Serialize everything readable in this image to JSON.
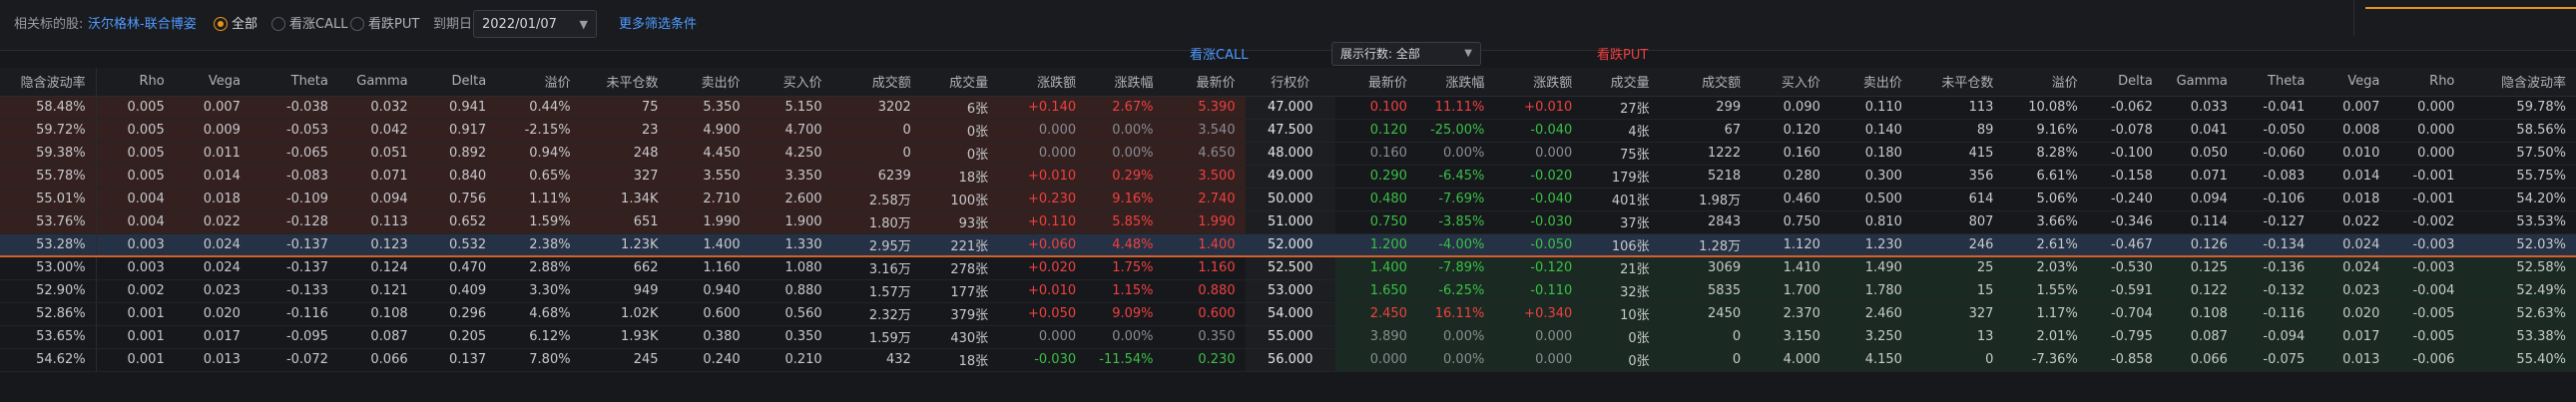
{
  "toolbar": {
    "related_label": "相关标的股:",
    "related_link": "沃尔格林-联合博姿",
    "filter_all": "全部",
    "filter_call": "看涨CALL",
    "filter_put": "看跌PUT",
    "expiry_label": "到期日",
    "expiry_value": "2022/01/07",
    "more_filters": "更多筛选条件"
  },
  "section": {
    "call_title": "看涨CALL",
    "put_title": "看跌PUT",
    "rows_label": "展示行数: 全部"
  },
  "colors": {
    "up": "#ef4040",
    "down": "#3bbf46",
    "accent": "#e8941b",
    "link": "#4f9bff",
    "itm_bg": "#33201f",
    "otm_bg": "#1a2a22"
  },
  "columns": [
    "隐含波动率",
    "Rho",
    "Vega",
    "Theta",
    "Gamma",
    "Delta",
    "溢价",
    "未平仓数",
    "卖出价",
    "买入价",
    "成交额",
    "成交量",
    "涨跌额",
    "涨跌幅",
    "最新价",
    "行权价",
    "最新价",
    "涨跌幅",
    "涨跌额",
    "成交量",
    "成交额",
    "买入价",
    "卖出价",
    "未平仓数",
    "溢价",
    "Delta",
    "Gamma",
    "Theta",
    "Vega",
    "Rho",
    "隐含波动率"
  ],
  "rows": [
    {
      "call": [
        "58.48%",
        "0.005",
        "0.007",
        "-0.038",
        "0.032",
        "0.941",
        "0.44%",
        "75",
        "5.350",
        "5.150",
        "3202",
        "6张",
        "+0.140",
        "2.67%",
        "5.390"
      ],
      "call_dir": "up",
      "strike": "47.000",
      "put": [
        "0.100",
        "11.11%",
        "+0.010",
        "27张",
        "299",
        "0.090",
        "0.110",
        "113",
        "10.08%",
        "-0.062",
        "0.033",
        "-0.041",
        "0.007",
        "0.000",
        "59.78%"
      ],
      "put_dir": "up"
    },
    {
      "call": [
        "59.72%",
        "0.005",
        "0.009",
        "-0.053",
        "0.042",
        "0.917",
        "-2.15%",
        "23",
        "4.900",
        "4.700",
        "0",
        "0张",
        "0.000",
        "0.00%",
        "3.540"
      ],
      "call_dir": "flat",
      "strike": "47.500",
      "put": [
        "0.120",
        "-25.00%",
        "-0.040",
        "4张",
        "67",
        "0.120",
        "0.140",
        "89",
        "9.16%",
        "-0.078",
        "0.041",
        "-0.050",
        "0.008",
        "0.000",
        "58.56%"
      ],
      "put_dir": "down"
    },
    {
      "call": [
        "59.38%",
        "0.005",
        "0.011",
        "-0.065",
        "0.051",
        "0.892",
        "0.94%",
        "248",
        "4.450",
        "4.250",
        "0",
        "0张",
        "0.000",
        "0.00%",
        "4.650"
      ],
      "call_dir": "flat",
      "strike": "48.000",
      "put": [
        "0.160",
        "0.00%",
        "0.000",
        "75张",
        "1222",
        "0.160",
        "0.180",
        "415",
        "8.28%",
        "-0.100",
        "0.050",
        "-0.060",
        "0.010",
        "0.000",
        "57.50%"
      ],
      "put_dir": "flat"
    },
    {
      "call": [
        "55.78%",
        "0.005",
        "0.014",
        "-0.083",
        "0.071",
        "0.840",
        "0.65%",
        "327",
        "3.550",
        "3.350",
        "6239",
        "18张",
        "+0.010",
        "0.29%",
        "3.500"
      ],
      "call_dir": "up",
      "strike": "49.000",
      "put": [
        "0.290",
        "-6.45%",
        "-0.020",
        "179张",
        "5218",
        "0.280",
        "0.300",
        "356",
        "6.61%",
        "-0.158",
        "0.071",
        "-0.083",
        "0.014",
        "-0.001",
        "55.75%"
      ],
      "put_dir": "down"
    },
    {
      "call": [
        "55.01%",
        "0.004",
        "0.018",
        "-0.109",
        "0.094",
        "0.756",
        "1.11%",
        "1.34K",
        "2.710",
        "2.600",
        "2.58万",
        "100张",
        "+0.230",
        "9.16%",
        "2.740"
      ],
      "call_dir": "up",
      "strike": "50.000",
      "put": [
        "0.480",
        "-7.69%",
        "-0.040",
        "401张",
        "1.98万",
        "0.460",
        "0.500",
        "614",
        "5.06%",
        "-0.240",
        "0.094",
        "-0.106",
        "0.018",
        "-0.001",
        "54.20%"
      ],
      "put_dir": "down"
    },
    {
      "call": [
        "53.76%",
        "0.004",
        "0.022",
        "-0.128",
        "0.113",
        "0.652",
        "1.59%",
        "651",
        "1.990",
        "1.900",
        "1.80万",
        "93张",
        "+0.110",
        "5.85%",
        "1.990"
      ],
      "call_dir": "up",
      "strike": "51.000",
      "put": [
        "0.750",
        "-3.85%",
        "-0.030",
        "37张",
        "2843",
        "0.750",
        "0.810",
        "807",
        "3.66%",
        "-0.346",
        "0.114",
        "-0.127",
        "0.022",
        "-0.002",
        "53.53%"
      ],
      "put_dir": "down"
    },
    {
      "call": [
        "53.28%",
        "0.003",
        "0.024",
        "-0.137",
        "0.123",
        "0.532",
        "2.38%",
        "1.23K",
        "1.400",
        "1.330",
        "2.95万",
        "221张",
        "+0.060",
        "4.48%",
        "1.400"
      ],
      "call_dir": "up",
      "strike": "52.000",
      "put": [
        "1.200",
        "-4.00%",
        "-0.050",
        "106张",
        "1.28万",
        "1.120",
        "1.230",
        "246",
        "2.61%",
        "-0.467",
        "0.126",
        "-0.134",
        "0.024",
        "-0.003",
        "52.03%"
      ],
      "put_dir": "down",
      "atm": true
    },
    {
      "call": [
        "53.00%",
        "0.003",
        "0.024",
        "-0.137",
        "0.124",
        "0.470",
        "2.88%",
        "662",
        "1.160",
        "1.080",
        "3.16万",
        "278张",
        "+0.020",
        "1.75%",
        "1.160"
      ],
      "call_dir": "up",
      "strike": "52.500",
      "put": [
        "1.400",
        "-7.89%",
        "-0.120",
        "21张",
        "3069",
        "1.410",
        "1.490",
        "25",
        "2.03%",
        "-0.530",
        "0.125",
        "-0.136",
        "0.024",
        "-0.003",
        "52.58%"
      ],
      "put_dir": "down"
    },
    {
      "call": [
        "52.90%",
        "0.002",
        "0.023",
        "-0.133",
        "0.121",
        "0.409",
        "3.30%",
        "949",
        "0.940",
        "0.880",
        "1.57万",
        "177张",
        "+0.010",
        "1.15%",
        "0.880"
      ],
      "call_dir": "up",
      "strike": "53.000",
      "put": [
        "1.650",
        "-6.25%",
        "-0.110",
        "32张",
        "5835",
        "1.700",
        "1.780",
        "15",
        "1.55%",
        "-0.591",
        "0.122",
        "-0.132",
        "0.023",
        "-0.004",
        "52.49%"
      ],
      "put_dir": "down"
    },
    {
      "call": [
        "52.86%",
        "0.001",
        "0.020",
        "-0.116",
        "0.108",
        "0.296",
        "4.68%",
        "1.02K",
        "0.600",
        "0.560",
        "2.32万",
        "379张",
        "+0.050",
        "9.09%",
        "0.600"
      ],
      "call_dir": "up",
      "strike": "54.000",
      "put": [
        "2.450",
        "16.11%",
        "+0.340",
        "10张",
        "2450",
        "2.370",
        "2.460",
        "327",
        "1.17%",
        "-0.704",
        "0.108",
        "-0.116",
        "0.020",
        "-0.005",
        "52.63%"
      ],
      "put_dir": "up"
    },
    {
      "call": [
        "53.65%",
        "0.001",
        "0.017",
        "-0.095",
        "0.087",
        "0.205",
        "6.12%",
        "1.93K",
        "0.380",
        "0.350",
        "1.59万",
        "430张",
        "0.000",
        "0.00%",
        "0.350"
      ],
      "call_dir": "flat",
      "strike": "55.000",
      "put": [
        "3.890",
        "0.00%",
        "0.000",
        "0张",
        "0",
        "3.150",
        "3.250",
        "13",
        "2.01%",
        "-0.795",
        "0.087",
        "-0.094",
        "0.017",
        "-0.005",
        "53.38%"
      ],
      "put_dir": "flat"
    },
    {
      "call": [
        "54.62%",
        "0.001",
        "0.013",
        "-0.072",
        "0.066",
        "0.137",
        "7.80%",
        "245",
        "0.240",
        "0.210",
        "432",
        "18张",
        "-0.030",
        "-11.54%",
        "0.230"
      ],
      "call_dir": "down",
      "strike": "56.000",
      "put": [
        "0.000",
        "0.00%",
        "0.000",
        "0张",
        "0",
        "4.000",
        "4.150",
        "0",
        "-7.36%",
        "-0.858",
        "0.066",
        "-0.075",
        "0.013",
        "-0.006",
        "55.40%"
      ],
      "put_dir": "flat"
    }
  ]
}
